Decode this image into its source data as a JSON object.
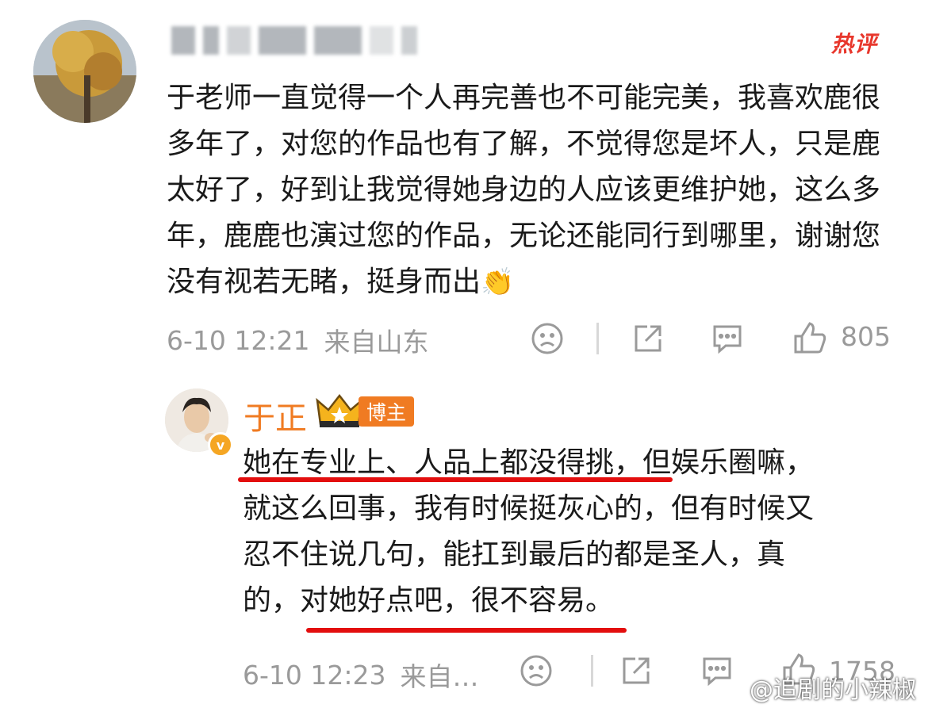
{
  "comment": {
    "badge": "热评",
    "text": "于老师一直觉得一个人再完善也不可能完美，我喜欢鹿很多年了，对您的作品也有了解，不觉得您是坏人，只是鹿太好了，好到让我觉得她身边的人应该更维护她，这么多年，鹿鹿也演过您的作品，无论还能同行到哪里，谢谢您没有视若无睹，挺身而出",
    "emoji": "👏",
    "timestamp": "6-10 12:21",
    "location": "来自山东",
    "like_count": "805",
    "icons": [
      "sad-face-icon",
      "share-icon",
      "comment-icon",
      "thumb-up-icon"
    ]
  },
  "reply": {
    "author": "于正",
    "author_badge": "博主",
    "verified_mark": "v",
    "text_lines": [
      {
        "underlined": "她在专业上、人品上都没得挑，",
        "rest": "但娱乐圈嘛，"
      },
      {
        "plain": "就这么回事，我有时候挺灰心的，但有时候又"
      },
      {
        "plain": "忍不住说几句，能扛到最后的都是圣人，真"
      },
      {
        "lead": "的，",
        "underlined": "对她好点吧，很不容易。"
      }
    ],
    "timestamp": "6-10 12:23",
    "location": "来自…",
    "like_count": "1758"
  },
  "watermark": "@追剧的小辣椒",
  "colors": {
    "accent_orange": "#f07b22",
    "hot_red": "#e8372c",
    "underline_red": "#e30e0e",
    "meta_gray": "#9a9a9a"
  }
}
